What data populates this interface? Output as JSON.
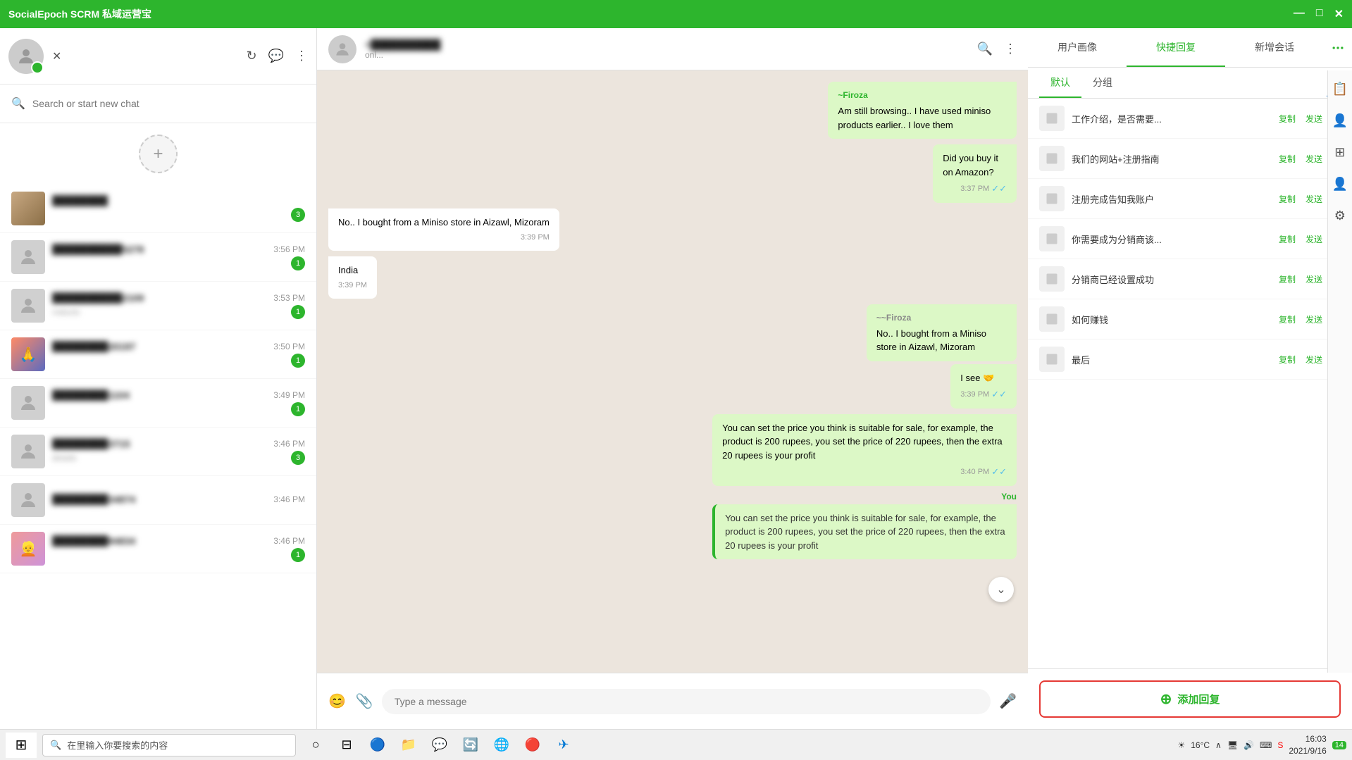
{
  "app": {
    "title": "SocialEpoch SCRM 私域运营宝",
    "controls": {
      "minimize": "—",
      "maximize": "□",
      "close": "✕"
    }
  },
  "sidebar": {
    "search_placeholder": "Search or start new chat",
    "add_button": "+",
    "chats": [
      {
        "id": 1,
        "name": "████████",
        "time": "",
        "preview": "",
        "badge": 0,
        "has_photo": true
      },
      {
        "id": 2,
        "name": "██████████5278",
        "time": "3:56 PM",
        "preview": "",
        "badge": 1
      },
      {
        "id": 3,
        "name": "██████████2109",
        "time": "3:53 PM",
        "preview": "roducts",
        "badge": 1
      },
      {
        "id": 4,
        "name": "████████20197",
        "time": "3:50 PM",
        "preview": "",
        "badge": 1,
        "has_photo": true
      },
      {
        "id": 5,
        "name": "████████1104",
        "time": "3:49 PM",
        "preview": "",
        "badge": 1
      },
      {
        "id": 6,
        "name": "████████3715",
        "time": "3:46 PM",
        "preview": "details",
        "badge": 3
      },
      {
        "id": 7,
        "name": "████████34874",
        "time": "3:46 PM",
        "preview": "",
        "badge": 0
      },
      {
        "id": 8,
        "name": "████████94834",
        "time": "3:46 PM",
        "preview": "",
        "badge": 1,
        "has_photo": true
      }
    ]
  },
  "chat": {
    "contact_name": "+██████████",
    "contact_status": "oni...",
    "messages": [
      {
        "id": 1,
        "type": "outgoing",
        "sender": "~Firoza",
        "text": "Am still browsing.. I have used miniso products earlier.. I love them",
        "time": "",
        "checked": false
      },
      {
        "id": 2,
        "type": "outgoing_self",
        "text": "Did you buy it on Amazon?",
        "time": "3:37 PM",
        "checked": true
      },
      {
        "id": 3,
        "type": "incoming",
        "text": "No.. I bought from a Miniso store in Aizawl, Mizoram",
        "time": "3:39 PM",
        "checked": false
      },
      {
        "id": 4,
        "type": "incoming",
        "text": "India",
        "time": "3:39 PM",
        "checked": false
      },
      {
        "id": 5,
        "type": "outgoing",
        "sender": "~~Firoza",
        "text": "No.. I bought from a Miniso store in Aizawl, Mizoram",
        "time": "",
        "checked": false
      },
      {
        "id": 6,
        "type": "outgoing_self",
        "text": "I see 🤝",
        "time": "3:39 PM",
        "checked": true
      },
      {
        "id": 7,
        "type": "outgoing_self_long",
        "text": "You can set the price you think is suitable for sale, for example, the product is 200 rupees, you set the price of 220 rupees, then the extra 20 rupees is your profit",
        "time": "3:40 PM",
        "checked": true
      },
      {
        "id": 8,
        "type": "you_preview",
        "you_label": "You",
        "text": "You can set the price you think is suitable for sale, for example, the product is 200 rupees, you set the price of 220 rupees, then the extra 20 rupees is your profit"
      }
    ],
    "input_placeholder": "Type a message"
  },
  "right_panel": {
    "tabs": [
      "用户画像",
      "快捷回复",
      "新增会话"
    ],
    "sub_tabs": [
      "默认",
      "分组"
    ],
    "quick_replies": [
      {
        "id": 1,
        "text": "工作介绍，是否需要..."
      },
      {
        "id": 2,
        "text": "我们的网站+注册指南"
      },
      {
        "id": 3,
        "text": "注册完成告知我账户"
      },
      {
        "id": 4,
        "text": "你需要成为分销商该..."
      },
      {
        "id": 5,
        "text": "分销商已经设置成功"
      },
      {
        "id": 6,
        "text": "如何赚钱"
      },
      {
        "id": 7,
        "text": "最后"
      }
    ],
    "copy_label": "复制",
    "send_label": "发送",
    "add_reply_label": "添加回复"
  },
  "taskbar": {
    "search_text": "在里输入你要搜索的内容",
    "weather": "16°C",
    "time": "16:03",
    "date": "2021/9/16",
    "notification_count": "14"
  }
}
